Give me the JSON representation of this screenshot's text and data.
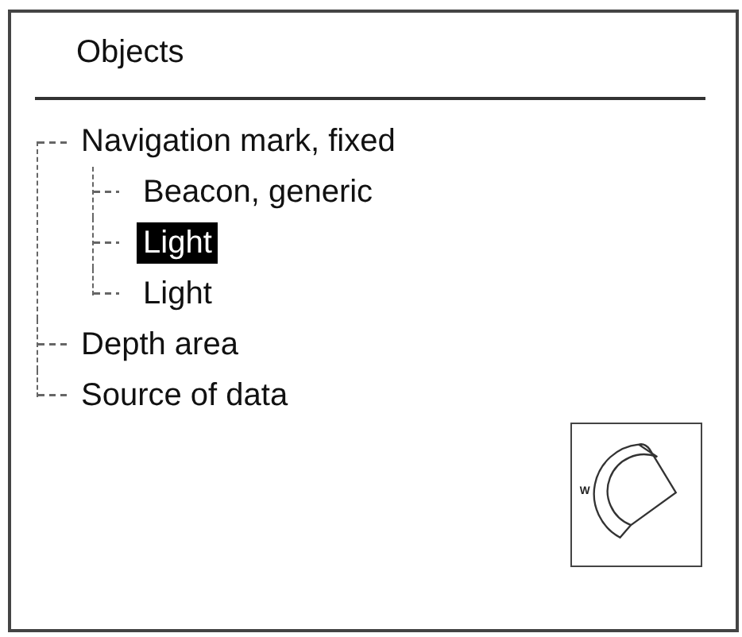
{
  "panel": {
    "title": "Objects"
  },
  "tree": [
    {
      "label": "Navigation mark, fixed",
      "selected": false,
      "children": [
        {
          "label": "Beacon, generic",
          "selected": false
        },
        {
          "label": "Light",
          "selected": true
        },
        {
          "label": "Light",
          "selected": false
        }
      ]
    },
    {
      "label": "Depth area",
      "selected": false
    },
    {
      "label": "Source of data",
      "selected": false
    }
  ],
  "symbol": {
    "label": "W"
  }
}
